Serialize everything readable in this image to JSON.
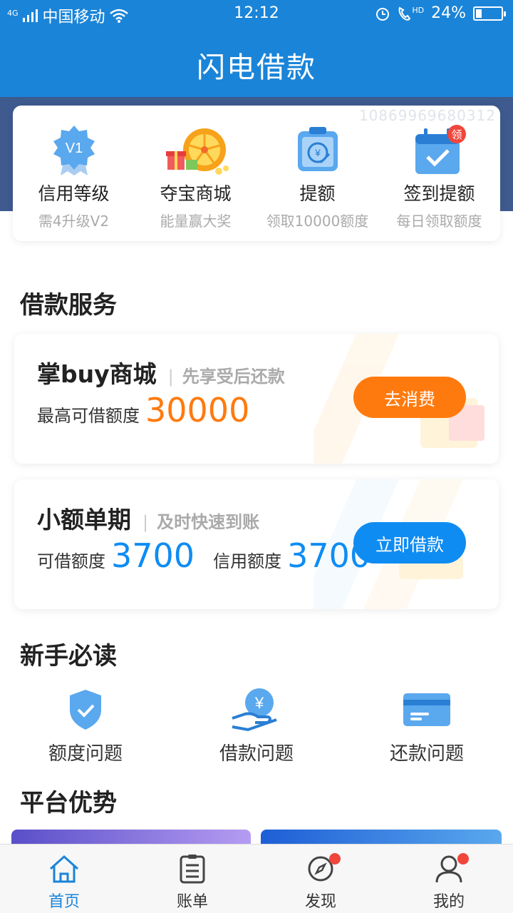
{
  "status_bar": {
    "carrier": "中国移动",
    "network": "4G",
    "time": "12:12",
    "battery": "24%",
    "battery_level": 0.24,
    "hd": "HD"
  },
  "header": {
    "title": "闪电借款"
  },
  "quick_card": {
    "id_number": "10869969680312",
    "items": [
      {
        "icon": "v1-badge-icon",
        "title": "信用等级",
        "subtitle": "需4升级V2",
        "badge": "V1"
      },
      {
        "icon": "lucky-wheel-icon",
        "title": "夺宝商城",
        "subtitle": "能量赢大奖"
      },
      {
        "icon": "raise-limit-icon",
        "title": "提额",
        "subtitle": "领取10000额度"
      },
      {
        "icon": "calendar-check-icon",
        "title": "签到提额",
        "subtitle": "每日领取额度",
        "tag": "领"
      }
    ]
  },
  "loan_section": {
    "title": "借款服务",
    "cards": [
      {
        "title": "掌buy商城",
        "slogan": "先享受后还款",
        "label1": "最高可借额度",
        "amount1": "30000",
        "button": "去消费"
      },
      {
        "title": "小额单期",
        "slogan": "及时快速到账",
        "label1": "可借额度",
        "amount1": "3700",
        "label2": "信用额度",
        "amount2": "3700",
        "button": "立即借款"
      }
    ]
  },
  "guide_section": {
    "title": "新手必读",
    "items": [
      {
        "icon": "shield-check-icon",
        "label": "额度问题"
      },
      {
        "icon": "hand-coin-icon",
        "label": "借款问题"
      },
      {
        "icon": "credit-card-icon",
        "label": "还款问题"
      }
    ]
  },
  "advantage_section": {
    "title": "平台优势"
  },
  "tab_bar": {
    "tabs": [
      {
        "icon": "home-icon",
        "label": "首页",
        "active": true
      },
      {
        "icon": "bill-icon",
        "label": "账单"
      },
      {
        "icon": "compass-icon",
        "label": "发现",
        "dot": true
      },
      {
        "icon": "user-icon",
        "label": "我的",
        "dot": true
      }
    ]
  },
  "colors": {
    "primary": "#1a84d8",
    "orange": "#ff7a0e",
    "blue_button": "#0f8cf2",
    "band": "#3e5a8e",
    "dot": "#f0463c"
  }
}
